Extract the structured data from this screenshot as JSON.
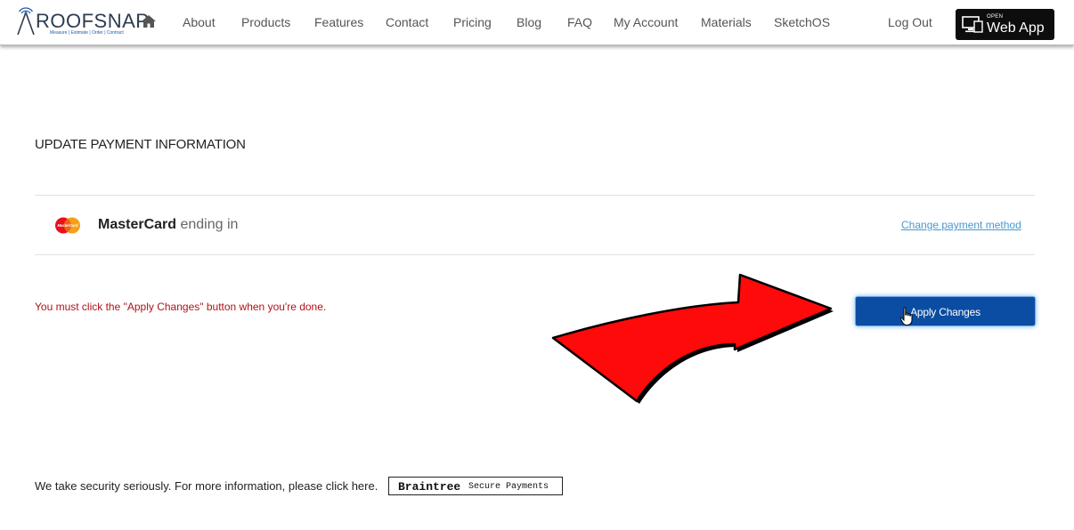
{
  "nav": {
    "logo_text": "ROOFSNAP",
    "logo_tagline": "Measure | Estimate | Order | Contract",
    "home_icon": "home-icon",
    "items": [
      "About",
      "Products",
      "Features",
      "Contact",
      "Pricing",
      "Blog",
      "FAQ",
      "My Account",
      "Materials",
      "SketchOS"
    ],
    "logout": "Log Out",
    "webapp": {
      "open_label": "OPEN",
      "label": "Web App",
      "icon": "monitor-icon"
    }
  },
  "page": {
    "title": "UPDATE PAYMENT INFORMATION",
    "card": {
      "brand": "MasterCard",
      "ending_text": "ending in",
      "logo_text": "MasterCard",
      "icon": "mastercard-icon"
    },
    "change_link": "Change payment method",
    "warning": "You must click the \"Apply Changes\" button when you're done.",
    "apply_button": "Apply Changes",
    "security_text": "We take security seriously. For more information, please click here.",
    "braintree": {
      "name": "Braintree",
      "subtitle": "Secure Payments"
    }
  },
  "colors": {
    "warning": "#b0121a",
    "link": "#4a98cf",
    "apply_button": "#0a4da2",
    "arrow": "#ff0000"
  }
}
